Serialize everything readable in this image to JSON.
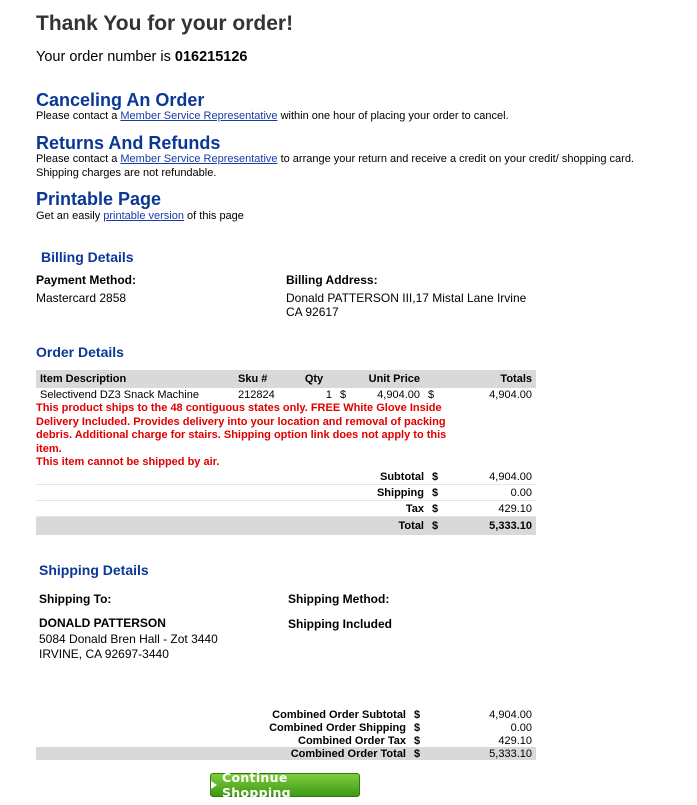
{
  "header": {
    "title": "Thank You for your order!",
    "order_prefix": "Your order number is ",
    "order_number": "016215126"
  },
  "canceling": {
    "title": "Canceling An Order",
    "pre": "Please contact a ",
    "link": "Member Service Representative",
    "post": " within one hour of placing your order to cancel."
  },
  "returns": {
    "title": "Returns And Refunds",
    "pre": "Please contact a ",
    "link": "Member Service Representative",
    "post": " to arrange your return and receive a credit on your credit/ shopping card.",
    "line2": "Shipping charges are not refundable."
  },
  "printable": {
    "title": "Printable Page",
    "pre": "Get an easily ",
    "link": "printable version",
    "post": " of this page"
  },
  "billing": {
    "title": "Billing Details",
    "payment_label": "Payment Method:",
    "payment_value": "Mastercard 2858",
    "address_label": "Billing Address:",
    "address_value": "Donald PATTERSON III,17 Mistal Lane Irvine CA 92617"
  },
  "order": {
    "title": "Order Details",
    "headers": {
      "description": "Item Description",
      "sku": "Sku #",
      "qty": "Qty",
      "unit_price": "Unit Price",
      "totals": "Totals"
    },
    "item": {
      "description": "Selectivend DZ3 Snack Machine",
      "sku": "212824",
      "qty": "1",
      "currency": "$",
      "unit_price": "4,904.00",
      "currency2": "$",
      "total": "4,904.00"
    },
    "note1": "This product ships to the 48 contiguous states only. FREE White Glove Inside Delivery Included. Provides delivery into your location and removal of packing debris. Additional charge for stairs. Shipping option link does not apply to this item.",
    "note2": "This item cannot be shipped by air.",
    "totals": {
      "subtotal_label": "Subtotal",
      "subtotal": "4,904.00",
      "shipping_label": "Shipping",
      "shipping": "0.00",
      "tax_label": "Tax",
      "tax": "429.10",
      "total_label": "Total",
      "total": "5,333.10",
      "currency": "$"
    }
  },
  "shipping": {
    "title": "Shipping Details",
    "to_label": "Shipping To:",
    "name": "DONALD PATTERSON",
    "addr1": "5084 Donald Bren Hall - Zot 3440",
    "addr2": "IRVINE, CA 92697-3440",
    "method_label": "Shipping Method:",
    "method_value": "Shipping Included"
  },
  "combined": {
    "subtotal_label": "Combined Order Subtotal",
    "subtotal": "4,904.00",
    "shipping_label": "Combined Order Shipping",
    "shipping": "0.00",
    "tax_label": "Combined Order Tax",
    "tax": "429.10",
    "total_label": "Combined Order Total",
    "total": "5,333.10",
    "currency": "$"
  },
  "button": {
    "label": "Continue Shopping",
    "icon": "play-triangle-icon",
    "color_top": "#7fcc3f",
    "color_bottom": "#3e9a14"
  },
  "colors": {
    "heading_blue": "#0b3797",
    "link_blue": "#1a3aa8",
    "warning_red": "#e00000",
    "table_header_gray": "#d9d9d9"
  }
}
